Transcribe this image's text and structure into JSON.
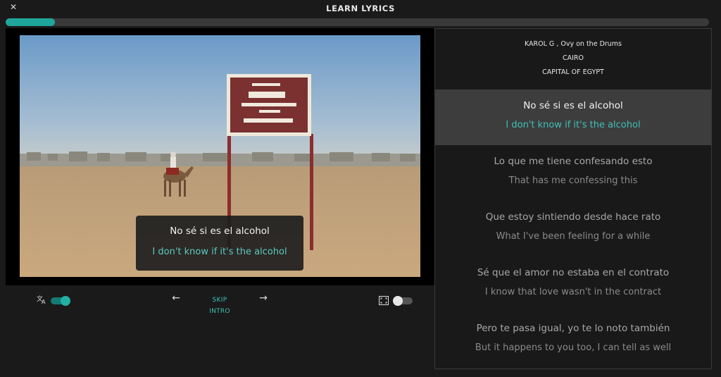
{
  "header": {
    "title": "LEARN LYRICS",
    "close_label": "✕"
  },
  "progress": {
    "value": 0.07,
    "color": "#1fa59b"
  },
  "video": {
    "caption": {
      "original": "No sé si es el alcohol",
      "translation": "I don't know if it's the alcohol"
    }
  },
  "controls": {
    "translate_toggle": {
      "on": true
    },
    "prev_label": "←",
    "skip_line1": "SKIP",
    "skip_line2": "INTRO",
    "next_label": "→",
    "fullscreen_toggle": {
      "on": false
    }
  },
  "lyrics_panel": {
    "artist": "KAROL G , Ovy on the Drums",
    "location": "CAIRO",
    "location_desc": "CAPITAL OF EGYPT",
    "lines": [
      {
        "original": "No sé si es el alcohol",
        "translation": "I don't know if it's the alcohol",
        "active": true
      },
      {
        "original": "Lo que me tiene confesando esto",
        "translation": "That has me confessing this",
        "active": false
      },
      {
        "original": "Que estoy sintiendo desde hace rato",
        "translation": "What I've been feeling for a while",
        "active": false
      },
      {
        "original": "Sé que el amor no estaba en el contrato",
        "translation": "I know that love wasn't in the contract",
        "active": false
      },
      {
        "original": "Pero te pasa igual, yo te lo noto también",
        "translation": "But it happens to you too, I can tell as well",
        "active": false
      }
    ]
  },
  "colors": {
    "accent": "#1fa59b",
    "accent_text": "#3fc0b6",
    "background": "#1a1a1a"
  }
}
